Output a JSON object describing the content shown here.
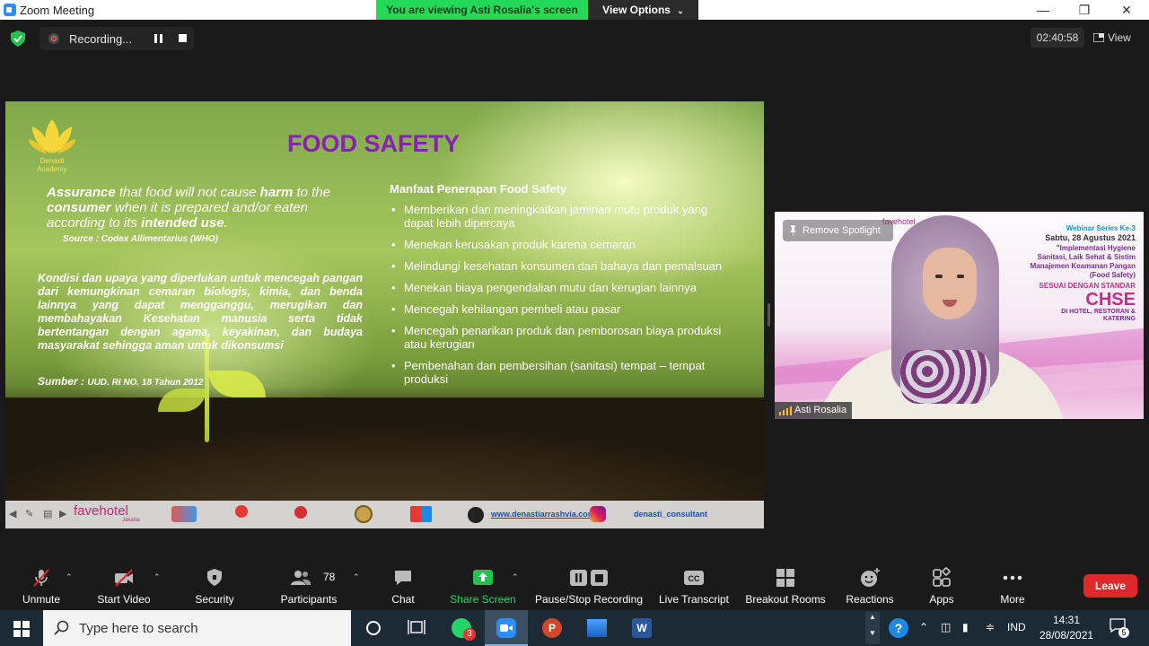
{
  "window": {
    "title": "Zoom Meeting",
    "viewing_banner": "You are viewing Asti Rosalia's screen",
    "view_options": "View Options",
    "minimize": "—",
    "maximize": "❐",
    "close": "✕"
  },
  "topbar": {
    "recording_label": "Recording...",
    "timer": "02:40:58",
    "view_label": "View"
  },
  "slide": {
    "logo_name_line1": "Denasti",
    "logo_name_line2": "Academy",
    "title": "FOOD SAFETY",
    "quote_part1": "Assurance",
    "quote_part2": " that food will not cause ",
    "quote_part3": "harm",
    "quote_part4": " to the ",
    "quote_part5": "consumer",
    "quote_part6": " when it is  prepared and/or  eaten according to its ",
    "quote_part7": "intended use",
    "quote_part8": ".",
    "source": "Source : Codex Allimentarius (WHO)",
    "kondisi": "Kondisi dan upaya yang diperlukan untuk mencegah pangan dari kemungkinan cemaran biologis, kimia, dan benda lainnya yang dapat mengganggu, merugikan dan membahayakan Kesehatan manusia serta tidak bertentangan dengan agama, keyakinan, dan budaya masyarakat sehingga aman untuk dikonsumsi",
    "sumber_label": "Sumber : ",
    "sumber_text": "UUD. RI NO. 18 Tahun 2012",
    "manfaat_title": "Manfaat Penerapan Food Safety",
    "manfaat_items": [
      "Memberikan dan meningkatkan jaminan mutu produk yang dapat lebih dipercaya",
      "Menekan kerusakan produk karena cemaran",
      "Melindungi kesehatan konsumen dari bahaya dan pemalsuan",
      "Menekan biaya pengendalian mutu dan kerugian lainnya",
      "Mencegah kehilangan pembeli atau pasar",
      "Mencegah penarikan produk dan pemborosan biaya produksi atau kerugian",
      "Pembenahan dan pembersihan (sanitasi) tempat – tempat produksi"
    ],
    "footer_brand": "favehotel",
    "footer_brand_sub": "Jakarta",
    "footer_url": "www.denastiarrashvia.com",
    "footer_ig": "denasti_consultant"
  },
  "video": {
    "spotlight_label": "Remove Spotlight",
    "participant_name": "Asti Rosalia",
    "brand": "favehotel",
    "webinar_series": "Webinar Series Ke-3",
    "webinar_date": "Sabtu, 28 Agustus 2021",
    "webinar_topic": "\"Implementasi Hygiene Sanitasi, Laik Sehat & Sistim Manajemen Keamanan Pangan (Food Safety)",
    "webinar_standard": "SESUAI DENGAN STANDAR",
    "webinar_chse": "CHSE",
    "webinar_chse_sub": "DI HOTEL, RESTORAN & KATERING"
  },
  "toolbar": {
    "unmute": "Unmute",
    "start_video": "Start Video",
    "security": "Security",
    "participants": "Participants",
    "participants_count": "78",
    "chat": "Chat",
    "share_screen": "Share Screen",
    "pause_stop": "Pause/Stop Recording",
    "live_transcript": "Live Transcript",
    "breakout_rooms": "Breakout Rooms",
    "reactions": "Reactions",
    "apps": "Apps",
    "more": "More",
    "leave": "Leave"
  },
  "taskbar": {
    "search_placeholder": "Type here to search",
    "whatsapp_badge": "3",
    "language": "IND",
    "time": "14:31",
    "date": "28/08/2021",
    "notification_count": "5"
  },
  "colors": {
    "share_green": "#23d959",
    "leave_red": "#e0282b",
    "slide_title_purple": "#8a1fb4",
    "taskbar_bg": "#1c2a36"
  }
}
